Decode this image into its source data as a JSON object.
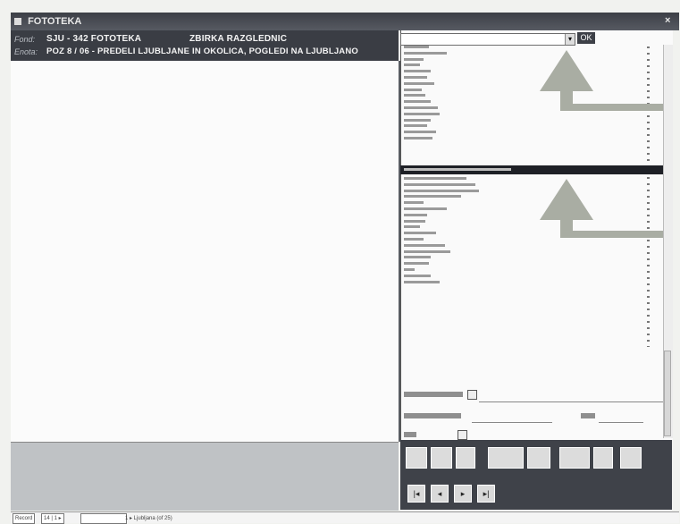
{
  "window": {
    "title": "FOTOTEKA",
    "close_glyph": "×"
  },
  "info": {
    "label1": "Fond:",
    "fond": "SJU - 342  FOTOTEKA",
    "collection": "ZBIRKA RAZGLEDNIC",
    "label2": "Enota:",
    "unit": "POZ 8 / 06 - PREDELI LJUBLJANE IN OKOLICA, POGLEDI NA LJUBLJANO"
  },
  "controls": {
    "ok_label": "OK"
  },
  "statusbar": {
    "record": "Record",
    "num": "14 | 1 ▸",
    "text": "1 ▸ Ljubljana (of 25)"
  },
  "colors": {
    "dark_panel": "#3a3d44",
    "arrow_gray": "#a9ada3",
    "selection": "#1e2026"
  },
  "icons": [
    "up-arrow-annotation",
    "window-icon",
    "close-icon",
    "dropdown-arrow-icon"
  ]
}
